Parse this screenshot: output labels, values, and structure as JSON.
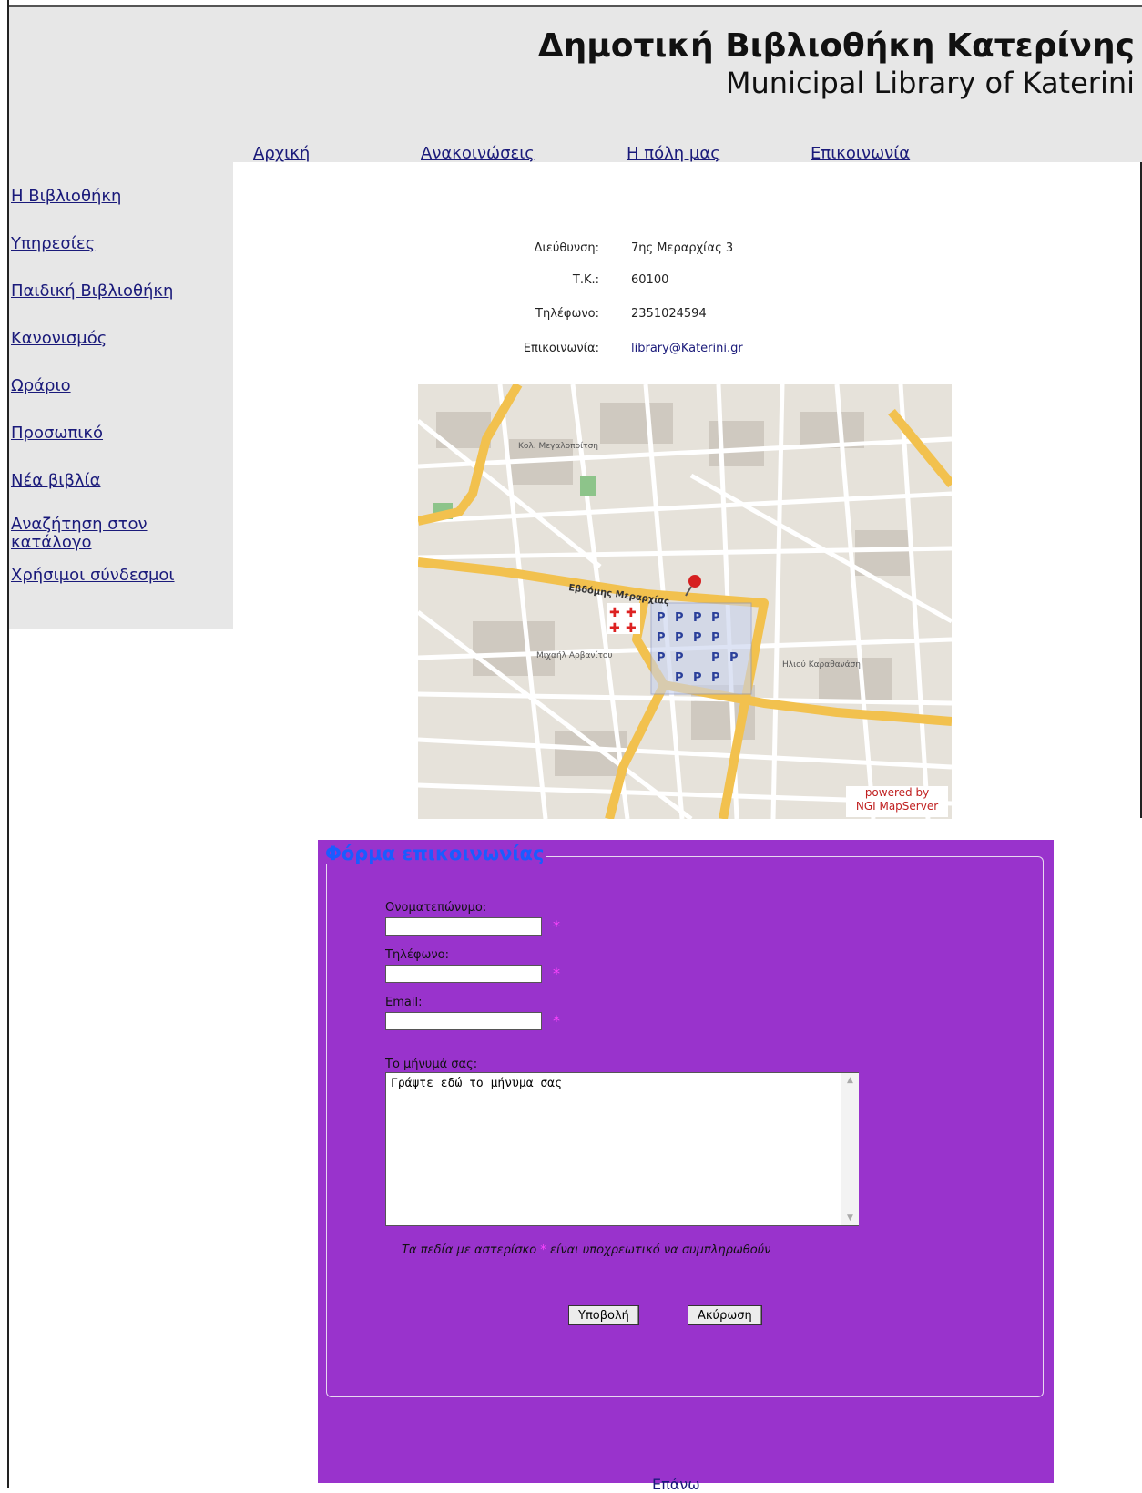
{
  "header": {
    "title_gr": "Δημοτική Βιβλιοθήκη Κατερίνης",
    "title_en": "Municipal Library of Katerini"
  },
  "topnav": [
    "Αρχική",
    "Ανακοινώσεις",
    "Η πόλη μας",
    "Επικοινωνία"
  ],
  "sidebar": {
    "items": [
      "Η Βιβλιοθήκη",
      "Υπηρεσίες",
      "Παιδική Βιβλιοθήκη",
      "Κανονισμός",
      "Ωράριο",
      "Προσωπικό",
      "Νέα βιβλία",
      "Αναζήτηση στον κατάλογο",
      "Χρήσιμοι σύνδεσμοι"
    ]
  },
  "contact_info": {
    "address_label": "Διεύθυνση:",
    "address_value": "7ης Μεραρχίας 3",
    "zip_label": "Τ.Κ.:",
    "zip_value": "60100",
    "phone_label": "Τηλέφωνο:",
    "phone_value": "2351024594",
    "contact_label": "Επικοινωνία:",
    "contact_value": "library@Katerini.gr"
  },
  "map": {
    "street_label": "Εβδόμης Μεραρχίας",
    "credit_line1": "powered by",
    "credit_line2": "NGI MapServer"
  },
  "form": {
    "legend": "Φόρμα επικοινωνίας",
    "name_label": "Ονοματεπώνυμο:",
    "phone_label": "Τηλέφωνο:",
    "email_label": "Email:",
    "message_label": "Το μήνυμά σας:",
    "message_value": "Γράψτε εδώ το μήνυμα σας",
    "required_star": "*",
    "note_before": "Τα πεδία με αστερίσκο",
    "note_after": "είναι υποχρεωτικό να συμπληρωθούν",
    "submit_label": "Υποβολή",
    "cancel_label": "Ακύρωση"
  },
  "footer": {
    "top_link": "Επάνω"
  }
}
